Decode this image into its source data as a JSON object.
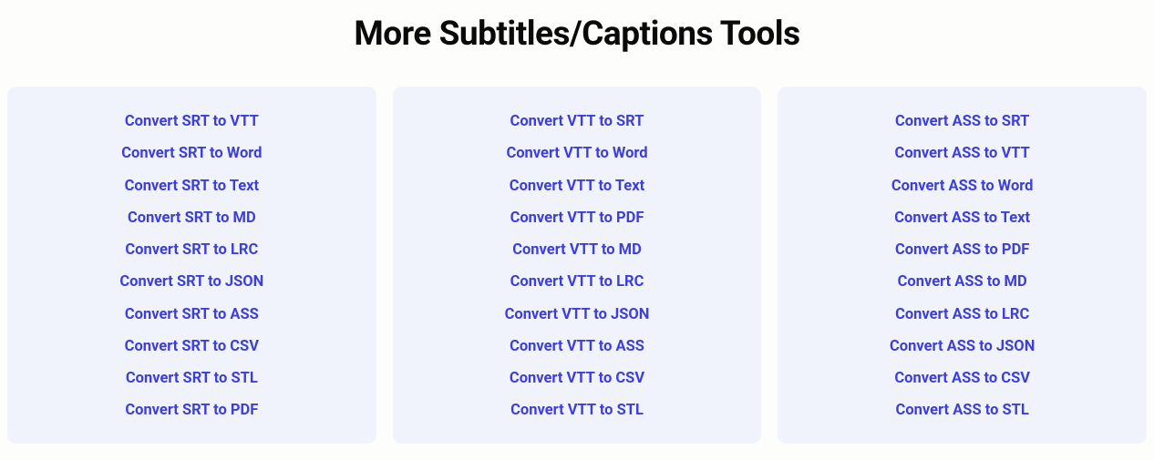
{
  "title": "More Subtitles/Captions Tools",
  "columns": [
    {
      "links": [
        "Convert SRT to VTT",
        "Convert SRT to Word",
        "Convert SRT to Text",
        "Convert SRT to MD",
        "Convert SRT to LRC",
        "Convert SRT to JSON",
        "Convert SRT to ASS",
        "Convert SRT to CSV",
        "Convert SRT to STL",
        "Convert SRT to PDF"
      ]
    },
    {
      "links": [
        "Convert VTT to SRT",
        "Convert VTT to Word",
        "Convert VTT to Text",
        "Convert VTT to PDF",
        "Convert VTT to MD",
        "Convert VTT to LRC",
        "Convert VTT to JSON",
        "Convert VTT to ASS",
        "Convert VTT to CSV",
        "Convert VTT to STL"
      ]
    },
    {
      "links": [
        "Convert ASS to SRT",
        "Convert ASS to VTT",
        "Convert ASS to Word",
        "Convert ASS to Text",
        "Convert ASS to PDF",
        "Convert ASS to MD",
        "Convert ASS to LRC",
        "Convert ASS to JSON",
        "Convert ASS to CSV",
        "Convert ASS to STL"
      ]
    }
  ]
}
